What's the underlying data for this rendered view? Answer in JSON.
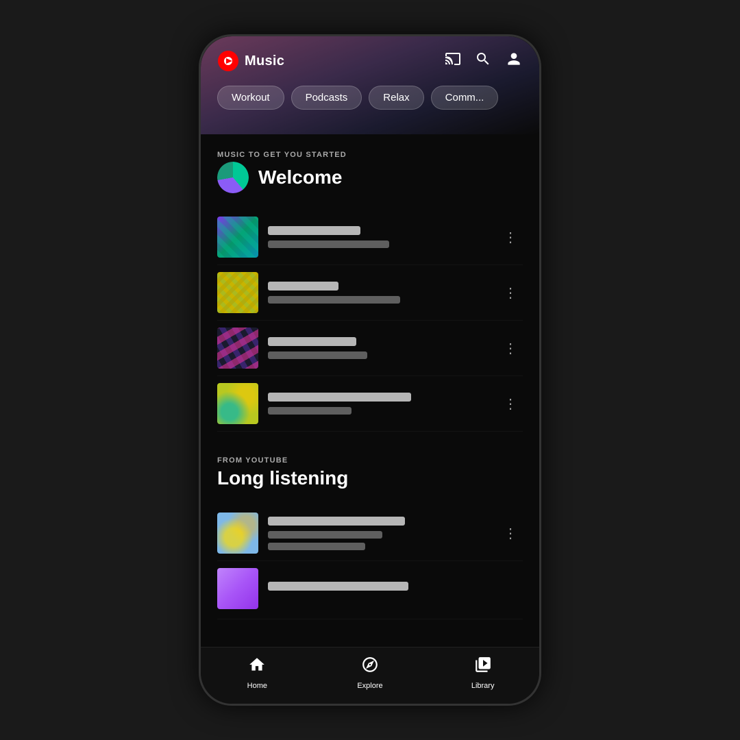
{
  "app": {
    "name": "Music",
    "logo_alt": "YouTube Music"
  },
  "header": {
    "cast_icon": "cast",
    "search_icon": "search",
    "account_icon": "account"
  },
  "categories": [
    {
      "label": "Workout",
      "active": false
    },
    {
      "label": "Podcasts",
      "active": false
    },
    {
      "label": "Relax",
      "active": false
    },
    {
      "label": "Comm...",
      "active": false
    }
  ],
  "sections": [
    {
      "eyebrow": "MUSIC TO GET YOU STARTED",
      "title": "Welcome",
      "has_avatar": true,
      "tracks": [
        {
          "title_width": "42%",
          "artist_width": "55%",
          "thumb_class": "thumb-1"
        },
        {
          "title_width": "32%",
          "artist_width": "60%",
          "thumb_class": "thumb-2"
        },
        {
          "title_width": "40%",
          "artist_width": "45%",
          "thumb_class": "thumb-3"
        },
        {
          "title_width": "65%",
          "artist_width": "38%",
          "thumb_class": "thumb-4"
        }
      ]
    },
    {
      "eyebrow": "FROM YOUTUBE",
      "title": "Long listening",
      "has_avatar": false,
      "tracks": [
        {
          "title_width": "62%",
          "artist_width": "52%",
          "thumb_class": "thumb-5"
        },
        {
          "title_width": "55%",
          "artist_width": "0%",
          "thumb_class": "thumb-6"
        }
      ]
    }
  ],
  "bottom_nav": [
    {
      "label": "Home",
      "icon": "home"
    },
    {
      "label": "Explore",
      "icon": "explore"
    },
    {
      "label": "Library",
      "icon": "library"
    }
  ],
  "eyebrow_1": "MUSIC TO GET YOU STARTED",
  "title_1": "Welcome",
  "eyebrow_2": "FROM YOUTUBE",
  "title_2": "Long listening",
  "cat_0": "Workout",
  "cat_1": "Podcasts",
  "cat_2": "Relax",
  "cat_3": "Comm...",
  "nav_home": "Home",
  "nav_explore": "Explore",
  "nav_library": "Library"
}
